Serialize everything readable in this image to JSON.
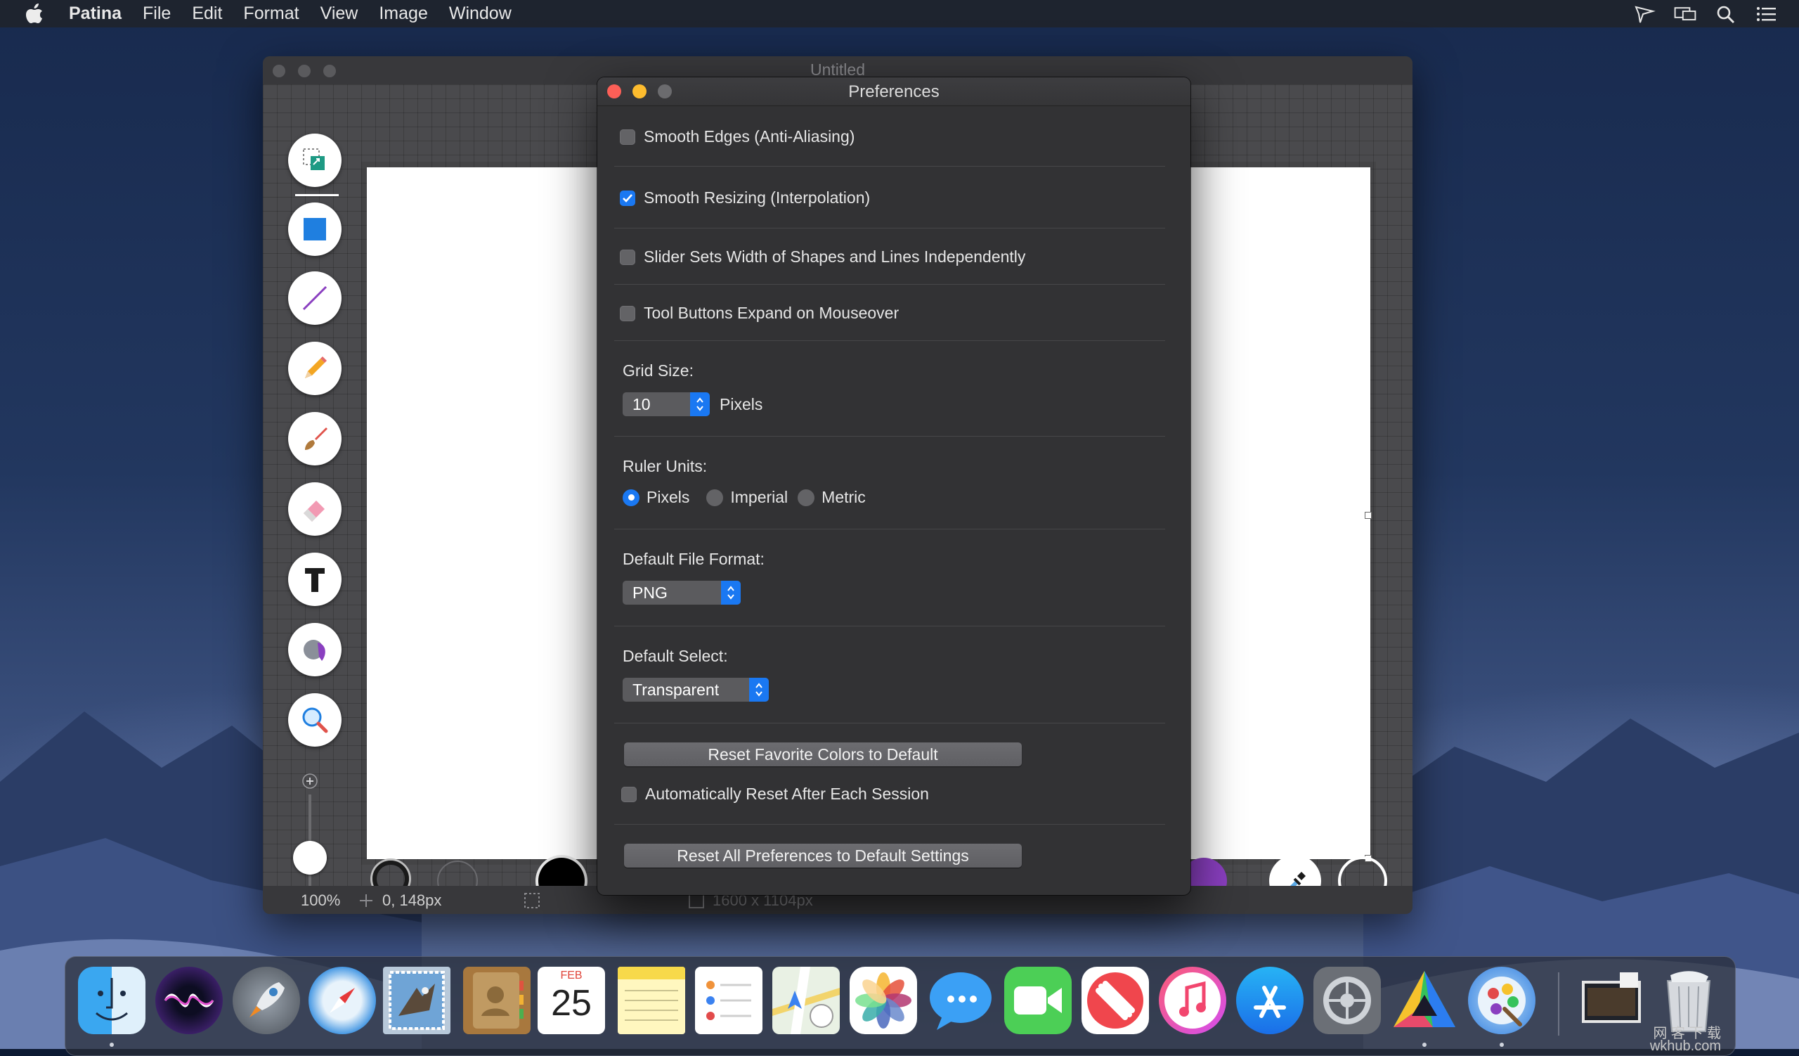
{
  "menubar": {
    "app_name": "Patina",
    "items": [
      "File",
      "Edit",
      "Format",
      "View",
      "Image",
      "Window"
    ]
  },
  "app_window": {
    "title": "Untitled",
    "status": {
      "zoom": "100%",
      "cursor_position": "0, 148px",
      "canvas_size": "1600 x 1104px"
    }
  },
  "preferences": {
    "title": "Preferences",
    "checkboxes": [
      {
        "label": "Smooth Edges (Anti-Aliasing)",
        "checked": false
      },
      {
        "label": "Smooth Resizing (Interpolation)",
        "checked": true
      },
      {
        "label": "Slider Sets Width of Shapes and Lines Independently",
        "checked": false
      },
      {
        "label": "Tool Buttons Expand on Mouseover",
        "checked": false
      }
    ],
    "grid_size": {
      "label": "Grid Size:",
      "value": "10",
      "unit": "Pixels"
    },
    "ruler_units": {
      "label": "Ruler Units:",
      "options": [
        "Pixels",
        "Imperial",
        "Metric"
      ],
      "selected": "Pixels"
    },
    "default_file_format": {
      "label": "Default File Format:",
      "value": "PNG"
    },
    "default_select": {
      "label": "Default Select:",
      "value": "Transparent"
    },
    "reset_colors_button": "Reset Favorite Colors to Default",
    "auto_reset": {
      "label": "Automatically Reset After Each Session",
      "checked": false
    },
    "reset_all_button": "Reset All Preferences to Default Settings"
  },
  "dock": {
    "calendar_month": "FEB",
    "calendar_day": "25",
    "watermark_line1": "网 客 下 载",
    "watermark_line2": "wkhub.com"
  },
  "colors": {
    "accent": "#1a78f2",
    "panel_bg": "#323234",
    "close": "#fc5f57",
    "minimize": "#fdbc2e",
    "swatch_purple": "#8a3fc0"
  }
}
